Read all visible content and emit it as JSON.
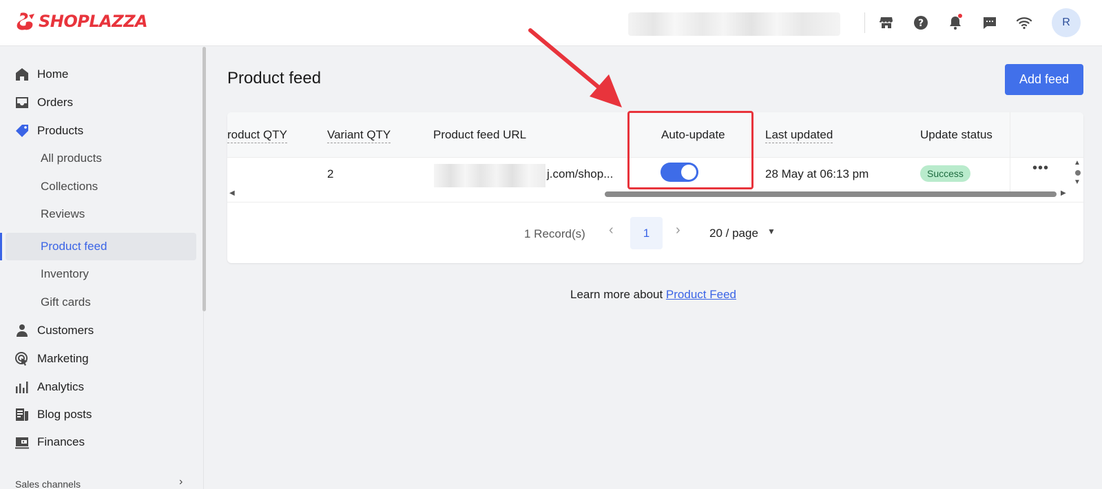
{
  "app": {
    "brand": "SHOPLAZZA",
    "avatar_initial": "R"
  },
  "topbar_icons": [
    "store-icon",
    "help-icon",
    "bell-icon",
    "chat-icon",
    "wifi-icon"
  ],
  "sidebar": {
    "items": [
      {
        "label": "Home",
        "icon": "home-icon"
      },
      {
        "label": "Orders",
        "icon": "inbox-icon"
      },
      {
        "label": "Products",
        "icon": "tag-icon"
      },
      {
        "label": "All products"
      },
      {
        "label": "Collections"
      },
      {
        "label": "Reviews"
      },
      {
        "label": "Product feed"
      },
      {
        "label": "Inventory"
      },
      {
        "label": "Gift cards"
      },
      {
        "label": "Customers",
        "icon": "person-icon"
      },
      {
        "label": "Marketing",
        "icon": "target-icon"
      },
      {
        "label": "Analytics",
        "icon": "bar-chart-icon"
      },
      {
        "label": "Blog posts",
        "icon": "blog-icon"
      },
      {
        "label": "Finances",
        "icon": "wallet-icon"
      }
    ],
    "sales_channels": "Sales channels"
  },
  "main": {
    "title": "Product feed",
    "add_button": "Add feed",
    "table": {
      "headers": {
        "product_qty": "roduct QTY",
        "variant_qty": "Variant QTY",
        "feed_url": "Product feed URL",
        "auto_update": "Auto-update",
        "last_updated": "Last updated",
        "update_status": "Update status"
      },
      "row": {
        "variant_qty": "2",
        "feed_url": "j.com/shop...",
        "auto_update_on": true,
        "last_updated": "28 May at 06:13 pm",
        "status": "Success",
        "more": "•••"
      }
    },
    "pagination": {
      "records": "1 Record(s)",
      "current_page": "1",
      "page_size": "20 / page"
    },
    "learn_more": {
      "prefix": "Learn more about ",
      "link": "Product Feed"
    }
  },
  "colors": {
    "brand": "#e8343c",
    "accent": "#3a64e6",
    "button": "#4170ea",
    "success_bg": "#b9ebcc",
    "annotation": "#e8343c"
  }
}
